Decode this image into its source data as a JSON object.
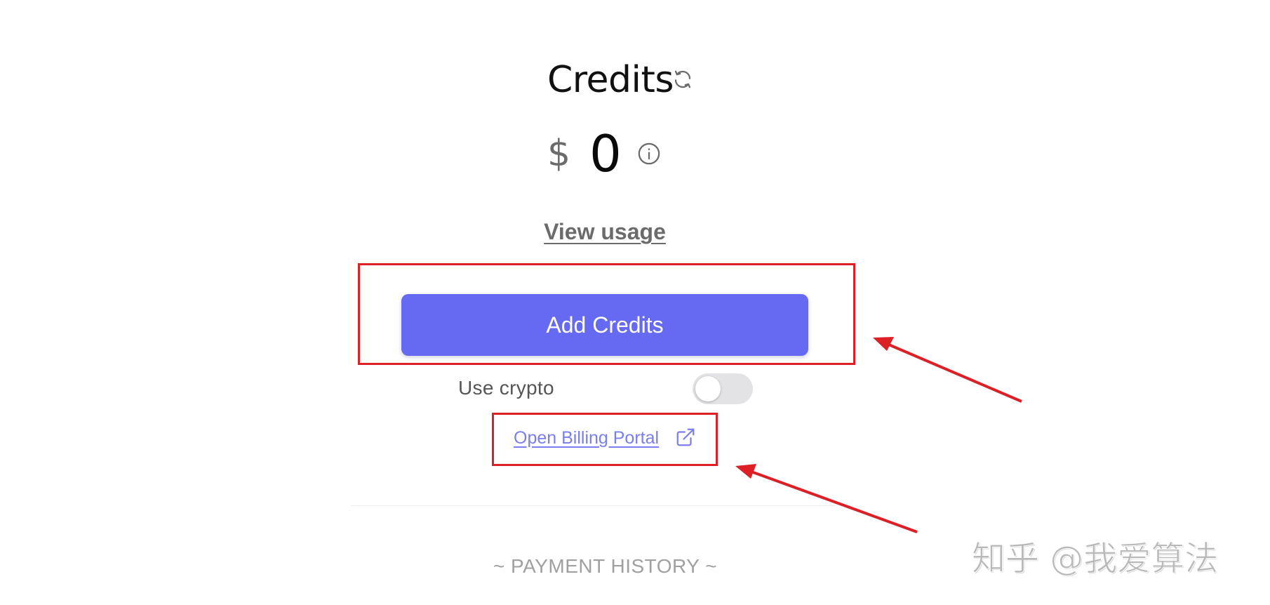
{
  "header": {
    "title": "Credits",
    "refresh_icon": "refresh-icon"
  },
  "balance": {
    "currency_symbol": "$",
    "amount": "0",
    "info_icon": "info-icon"
  },
  "links": {
    "view_usage": "View usage",
    "billing_portal": "Open Billing Portal",
    "billing_portal_icon": "external-link-icon"
  },
  "actions": {
    "add_credits_label": "Add Credits"
  },
  "crypto": {
    "label": "Use crypto",
    "enabled": false
  },
  "sections": {
    "payment_history": "~ PAYMENT HISTORY ~"
  },
  "watermark": {
    "text": "知乎 @我爱算法"
  },
  "colors": {
    "accent": "#6669f1",
    "link": "#7b7ef0",
    "annotation": "#dd1f26",
    "toggle_off": "#e3e3e6"
  }
}
